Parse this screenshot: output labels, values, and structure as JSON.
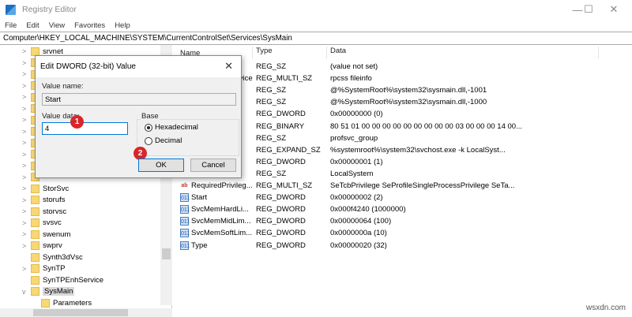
{
  "window": {
    "title": "Registry Editor",
    "minimize": "—",
    "maximize": "☐",
    "close": "✕"
  },
  "menu": [
    "File",
    "Edit",
    "View",
    "Favorites",
    "Help"
  ],
  "address": "Computer\\HKEY_LOCAL_MACHINE\\SYSTEM\\CurrentControlSet\\Services\\SysMain",
  "tree": [
    {
      "label": "srvnet",
      "chev": ">"
    },
    {
      "label": "",
      "chev": ">"
    },
    {
      "label": "",
      "chev": ">"
    },
    {
      "label": "",
      "chev": ">"
    },
    {
      "label": "",
      "chev": ">"
    },
    {
      "label": "",
      "chev": ">"
    },
    {
      "label": "",
      "chev": ">"
    },
    {
      "label": "",
      "chev": ">"
    },
    {
      "label": "",
      "chev": ">"
    },
    {
      "label": "",
      "chev": ">"
    },
    {
      "label": "",
      "chev": ">"
    },
    {
      "label": "",
      "chev": ">"
    },
    {
      "label": "StorSvc",
      "chev": ">"
    },
    {
      "label": "storufs",
      "chev": ">"
    },
    {
      "label": "storvsc",
      "chev": ">"
    },
    {
      "label": "svsvc",
      "chev": ">"
    },
    {
      "label": "swenum",
      "chev": ">"
    },
    {
      "label": "swprv",
      "chev": ">"
    },
    {
      "label": "Synth3dVsc",
      "chev": ""
    },
    {
      "label": "SynTP",
      "chev": ">"
    },
    {
      "label": "SynTPEnhService",
      "chev": ""
    },
    {
      "label": "SysMain",
      "chev": "v",
      "selected": true
    },
    {
      "label": "Parameters",
      "chev": "",
      "child": true
    }
  ],
  "list": {
    "headers": [
      "Name",
      "Type",
      "Data"
    ],
    "rows": [
      {
        "name": "",
        "type": "REG_SZ",
        "data": "(value not set)",
        "icon": "sz"
      },
      {
        "name": "DependOnService",
        "type": "REG_MULTI_SZ",
        "data": "rpcss fileinfo",
        "icon": "sz"
      },
      {
        "name": "",
        "type": "REG_SZ",
        "data": "@%SystemRoot%\\system32\\sysmain.dll,-1001",
        "icon": "sz"
      },
      {
        "name": "",
        "type": "REG_SZ",
        "data": "@%SystemRoot%\\system32\\sysmain.dll,-1000",
        "icon": "sz"
      },
      {
        "name": "",
        "type": "REG_DWORD",
        "data": "0x00000000 (0)",
        "icon": "dw"
      },
      {
        "name": "",
        "type": "REG_BINARY",
        "data": "80 51 01 00 00 00 00 00 00 00 00 00 03 00 00 00 14 00...",
        "icon": "dw"
      },
      {
        "name": "",
        "type": "REG_SZ",
        "data": "profsvc_group",
        "icon": "sz"
      },
      {
        "name": "",
        "type": "REG_EXPAND_SZ",
        "data": "%systemroot%\\system32\\svchost.exe -k LocalSyst...",
        "icon": "sz"
      },
      {
        "name": "",
        "type": "REG_DWORD",
        "data": "0x00000001 (1)",
        "icon": "dw"
      },
      {
        "name": "",
        "type": "REG_SZ",
        "data": "LocalSystem",
        "icon": "sz"
      },
      {
        "name": "RequiredPrivileg...",
        "type": "REG_MULTI_SZ",
        "data": "SeTcbPrivilege SeProfileSingleProcessPrivilege SeTa...",
        "icon": "sz"
      },
      {
        "name": "Start",
        "type": "REG_DWORD",
        "data": "0x00000002 (2)",
        "icon": "dw"
      },
      {
        "name": "SvcMemHardLi...",
        "type": "REG_DWORD",
        "data": "0x000f4240 (1000000)",
        "icon": "dw"
      },
      {
        "name": "SvcMemMidLim...",
        "type": "REG_DWORD",
        "data": "0x00000064 (100)",
        "icon": "dw"
      },
      {
        "name": "SvcMemSoftLim...",
        "type": "REG_DWORD",
        "data": "0x0000000a (10)",
        "icon": "dw"
      },
      {
        "name": "Type",
        "type": "REG_DWORD",
        "data": "0x00000020 (32)",
        "icon": "dw"
      }
    ]
  },
  "dialog": {
    "title": "Edit DWORD (32-bit) Value",
    "close": "✕",
    "value_name_label": "Value name:",
    "value_name": "Start",
    "value_data_label": "Value data:",
    "value_data": "4",
    "base_label": "Base",
    "hex": "Hexadecimal",
    "dec": "Decimal",
    "ok": "OK",
    "cancel": "Cancel",
    "badge1": "1",
    "badge2": "2"
  },
  "watermark": "wsxdn.com"
}
